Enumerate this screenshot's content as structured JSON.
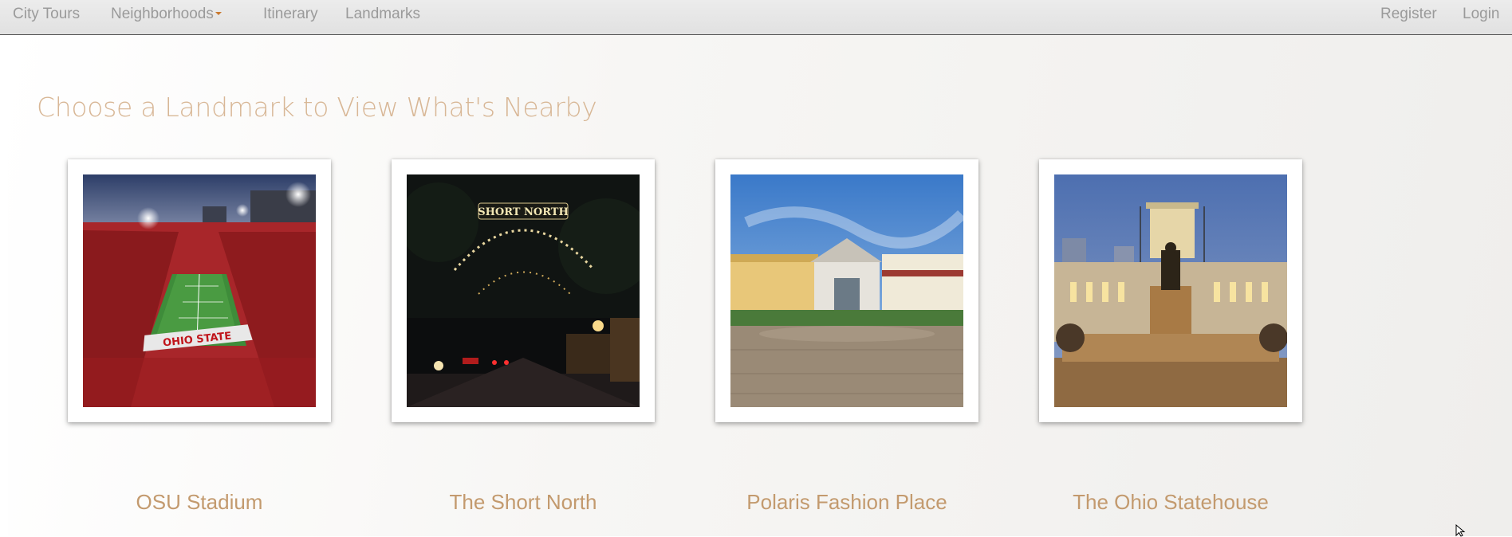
{
  "nav": {
    "brand": "City Tours",
    "items": [
      {
        "label": "Neighborhoods",
        "dropdown": true
      },
      {
        "label": "Itinerary"
      },
      {
        "label": "Landmarks"
      }
    ],
    "right_items": [
      {
        "label": "Register"
      },
      {
        "label": "Login"
      }
    ]
  },
  "main": {
    "title": "Choose a Landmark to View What's Nearby",
    "landmarks": [
      {
        "name": "OSU Stadium",
        "image_sign": "OHIO STATE"
      },
      {
        "name": "The Short North",
        "image_sign": "SHORT NORTH"
      },
      {
        "name": "Polaris Fashion Place"
      },
      {
        "name": "The Ohio Statehouse"
      }
    ]
  },
  "colors": {
    "accent": "#c9782e",
    "title": "#d8b796",
    "label": "#c39a6e",
    "nav_text": "#9a9a9a"
  }
}
